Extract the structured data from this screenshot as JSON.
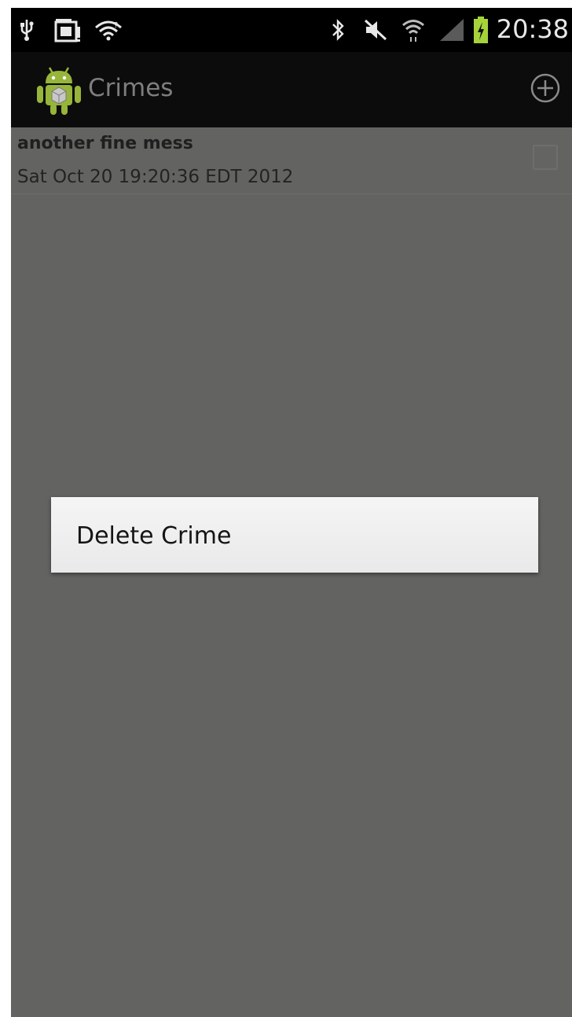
{
  "status_bar": {
    "time": "20:38",
    "icons": [
      "usb-icon",
      "sd-card-icon",
      "wifi-notification-icon",
      "bluetooth-icon",
      "mute-icon",
      "wifi-icon",
      "signal-icon",
      "battery-charging-icon"
    ]
  },
  "action_bar": {
    "title": "Crimes",
    "add_icon": "plus-circle-icon"
  },
  "crime_list": [
    {
      "title": "another fine mess",
      "date": "Sat Oct 20 19:20:36 EDT 2012",
      "solved": false
    }
  ],
  "context_menu": {
    "items": [
      {
        "label": "Delete Crime"
      }
    ]
  },
  "colors": {
    "screen_bg": "#636462",
    "action_bar": "#0b0c0b",
    "status_bar": "#000000",
    "android_green": "#97b53a",
    "battery_green": "#a6d33b",
    "menu_bg": "#f2f2f2"
  }
}
